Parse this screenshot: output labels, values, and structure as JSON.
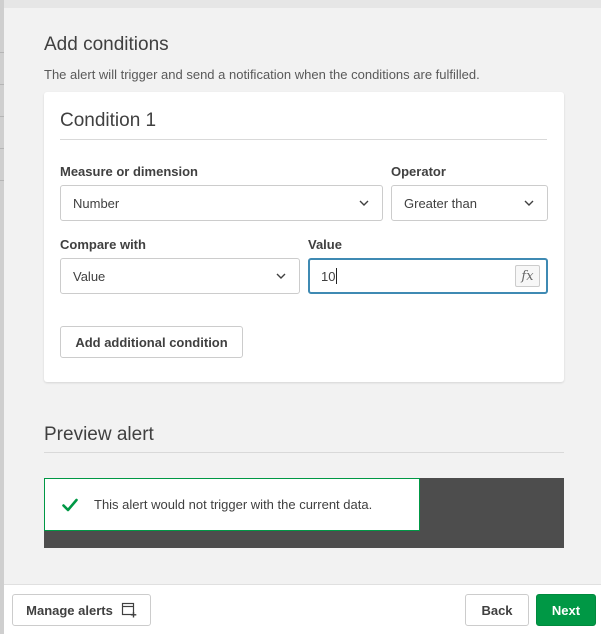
{
  "dialog": {
    "title": "Add conditions",
    "description": "The alert will trigger and send a notification when the conditions are fulfilled."
  },
  "condition": {
    "title": "Condition 1",
    "measure_label": "Measure or dimension",
    "measure_value": "Number",
    "operator_label": "Operator",
    "operator_value": "Greater than",
    "compare_label": "Compare with",
    "compare_value": "Value",
    "value_label": "Value",
    "value_input": "10",
    "fx_label": "fx",
    "add_condition_label": "Add additional condition"
  },
  "preview": {
    "title": "Preview alert",
    "message": "This alert would not trigger with the current data.",
    "status_icon": "check-icon",
    "status_color": "#009845"
  },
  "footer": {
    "manage_alerts_label": "Manage alerts",
    "manage_alerts_icon": "add-sheet-icon",
    "back_label": "Back",
    "next_label": "Next"
  },
  "colors": {
    "accent": "#009845",
    "focus_border": "#3f8ab3",
    "preview_bg": "#4d4d4d"
  }
}
